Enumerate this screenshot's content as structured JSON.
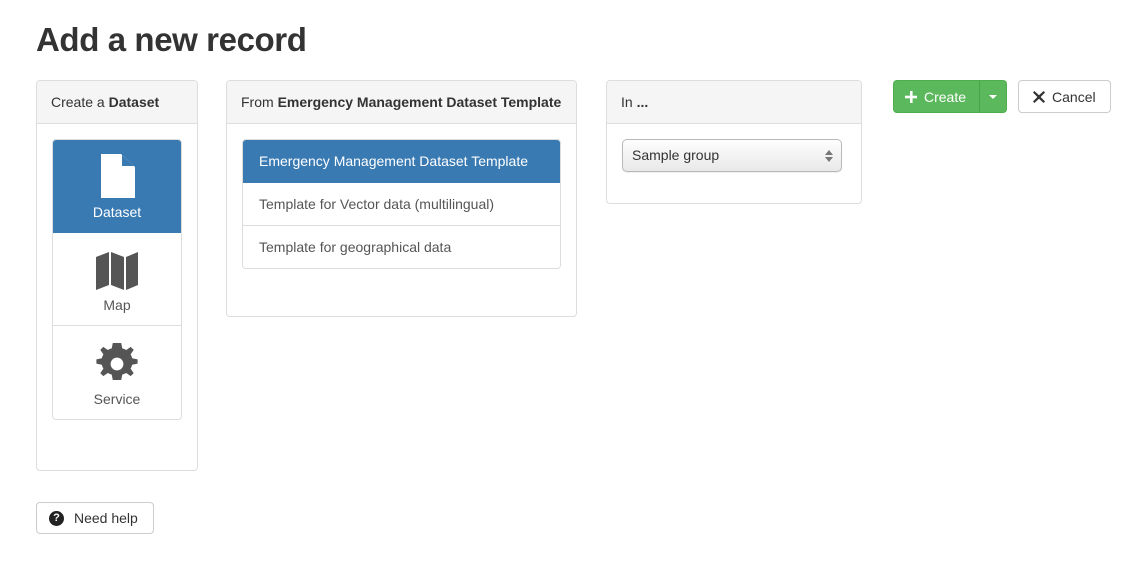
{
  "page": {
    "title": "Add a new record"
  },
  "type_panel": {
    "heading_prefix": "Create a ",
    "heading_strong": "Dataset",
    "items": [
      {
        "label": "Dataset",
        "icon": "document-icon",
        "active": true
      },
      {
        "label": "Map",
        "icon": "map-icon",
        "active": false
      },
      {
        "label": "Service",
        "icon": "gear-icon",
        "active": false
      }
    ]
  },
  "template_panel": {
    "heading_prefix": "From ",
    "heading_strong": "Emergency Management Dataset Template",
    "items": [
      {
        "label": "Emergency Management Dataset Template",
        "active": true
      },
      {
        "label": "Template for Vector data (multilingual)",
        "active": false
      },
      {
        "label": "Template for geographical data",
        "active": false
      }
    ]
  },
  "group_panel": {
    "heading_prefix": "In ",
    "heading_strong": "...",
    "select": {
      "value": "Sample group",
      "options": [
        "Sample group"
      ]
    }
  },
  "actions": {
    "create_label": "Create",
    "create_icon": "plus-icon",
    "caret_icon": "chevron-down-icon",
    "cancel_label": "Cancel",
    "cancel_icon": "close-icon"
  },
  "help": {
    "label": "Need help",
    "icon": "question-circle-icon",
    "glyph": "?"
  },
  "colors": {
    "primary": "#3a7ab3",
    "success": "#5cb85c",
    "panel_heading_bg": "#f5f5f5",
    "border": "#dddddd",
    "text": "#333333",
    "muted_text": "#555555"
  }
}
